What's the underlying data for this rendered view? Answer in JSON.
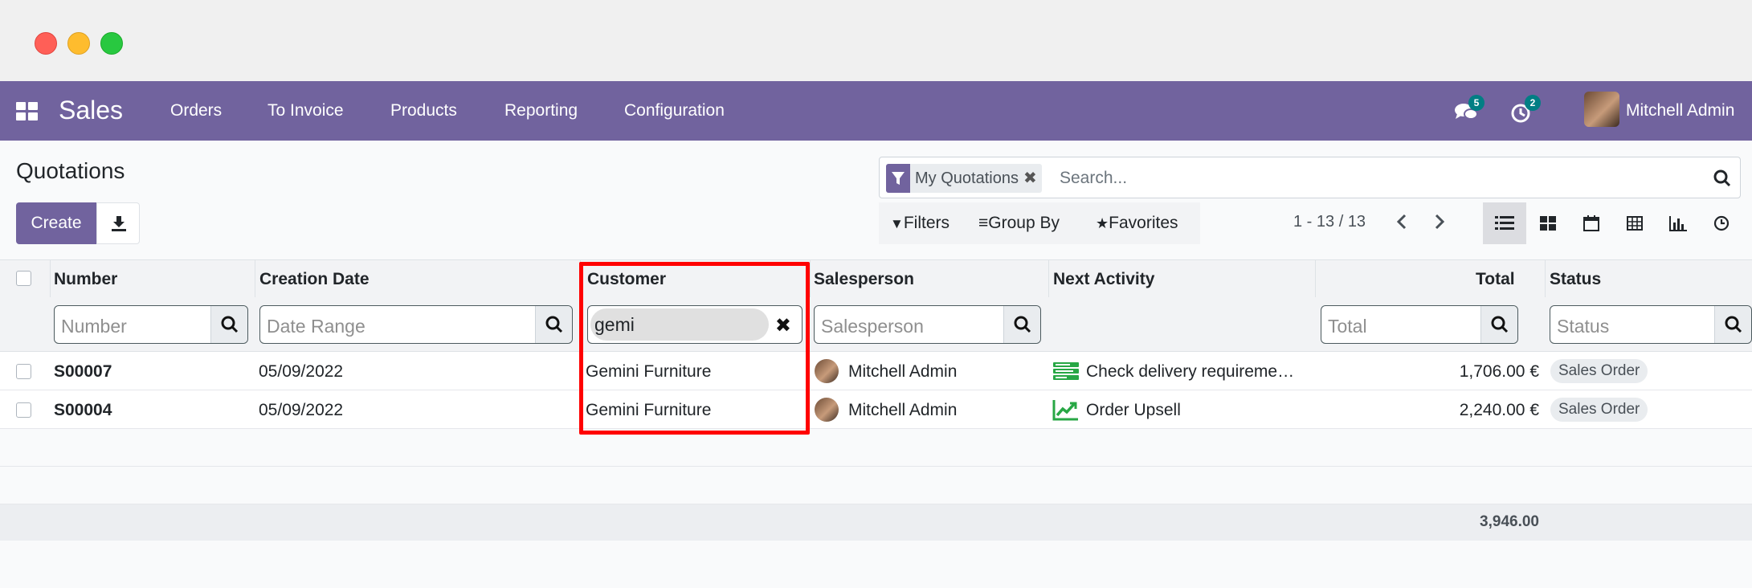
{
  "app": {
    "name": "Sales",
    "menu": [
      "Orders",
      "To Invoice",
      "Products",
      "Reporting",
      "Configuration"
    ],
    "messages_count": "5",
    "activities_count": "2",
    "user": "Mitchell Admin"
  },
  "page": {
    "title": "Quotations",
    "create_label": "Create"
  },
  "search": {
    "facet_label": "My Quotations",
    "placeholder": "Search...",
    "filters_label": "Filters",
    "groupby_label": "Group By",
    "favorites_label": "Favorites"
  },
  "pager": {
    "text": "1 - 13 / 13"
  },
  "columns": {
    "number": "Number",
    "creation_date": "Creation Date",
    "customer": "Customer",
    "salesperson": "Salesperson",
    "next_activity": "Next Activity",
    "total": "Total",
    "status": "Status"
  },
  "column_filters": {
    "number_placeholder": "Number",
    "date_placeholder": "Date Range",
    "customer_value": "gemi",
    "salesperson_placeholder": "Salesperson",
    "total_placeholder": "Total",
    "status_placeholder": "Status"
  },
  "rows": [
    {
      "number": "S00007",
      "date": "05/09/2022",
      "customer": "Gemini Furniture",
      "salesperson": "Mitchell Admin",
      "activity": "Check delivery requireme…",
      "total": "1,706.00 €",
      "status": "Sales Order"
    },
    {
      "number": "S00004",
      "date": "05/09/2022",
      "customer": "Gemini Furniture",
      "salesperson": "Mitchell Admin",
      "activity": "Order Upsell",
      "total": "2,240.00 €",
      "status": "Sales Order"
    }
  ],
  "footer": {
    "grand_total": "3,946.00"
  },
  "colors": {
    "brand": "#71639e",
    "highlight": "#ff0000",
    "activity_green": "#28a745"
  }
}
